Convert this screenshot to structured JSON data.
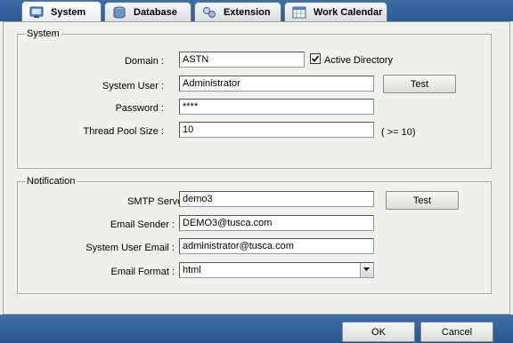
{
  "tabs": [
    {
      "label": "System",
      "icon": "system-icon",
      "active": true
    },
    {
      "label": "Database",
      "icon": "database-icon"
    },
    {
      "label": "Extension",
      "icon": "extension-icon"
    },
    {
      "label": "Work Calendar",
      "icon": "calendar-icon"
    }
  ],
  "system": {
    "legend": "System",
    "domain_label": "Domain :",
    "domain_value": "ASTN",
    "active_directory_label": "Active Directory",
    "active_directory_checked": true,
    "user_label": "System User :",
    "user_value": "Administrator",
    "test_label": "Test",
    "password_label": "Password :",
    "password_value": "****",
    "pool_label": "Thread Pool Size :",
    "pool_value": "10",
    "pool_hint": "( >= 10)"
  },
  "notification": {
    "legend": "Notification",
    "smtp_label": "SMTP Server :",
    "smtp_value": "demo3",
    "test_label": "Test",
    "sender_label": "Email Sender :",
    "sender_value": "DEMO3@tusca.com",
    "user_email_label": "System User Email :",
    "user_email_value": "administrator@tusca.com",
    "format_label": "Email Format :",
    "format_value": "html"
  },
  "footer": {
    "ok_label": "OK",
    "cancel_label": "Cancel"
  },
  "colors": {
    "tabbar": "#2d5a93",
    "panel": "#f0efe9"
  }
}
